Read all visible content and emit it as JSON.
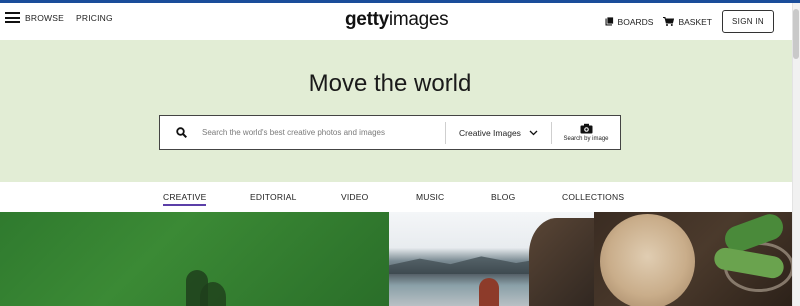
{
  "header": {
    "nav_left": {
      "browse": "BROWSE",
      "pricing": "PRICING"
    },
    "logo": {
      "bold": "getty",
      "light": "images"
    },
    "nav_right": {
      "boards": "BOARDS",
      "basket": "BASKET",
      "signin": "SIGN IN"
    }
  },
  "hero": {
    "title": "Move the world",
    "search": {
      "placeholder": "Search the world's best creative photos and images",
      "type_selected": "Creative Images",
      "by_image_label": "Search by image"
    }
  },
  "tabs": [
    {
      "label": "CREATIVE",
      "active": true
    },
    {
      "label": "EDITORIAL",
      "active": false
    },
    {
      "label": "VIDEO",
      "active": false
    },
    {
      "label": "MUSIC",
      "active": false
    },
    {
      "label": "BLOG",
      "active": false
    },
    {
      "label": "COLLECTIONS",
      "active": false
    }
  ],
  "colors": {
    "hero_bg": "#e2edd5",
    "active_tab_underline": "#5b3fa8",
    "top_border": "#1a4d9a"
  }
}
